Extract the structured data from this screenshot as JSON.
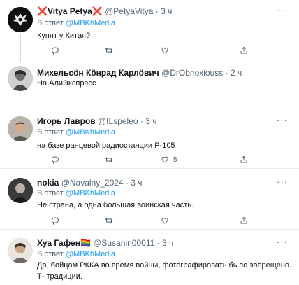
{
  "reply_prefix": "В ответ",
  "tweets": [
    {
      "display_name": "Vitya Petya",
      "cross_left": "❌",
      "cross_right": "❌",
      "handle": "@PetyaVitya",
      "separator": "·",
      "time": "3 ч",
      "reply_mention": "@MBKhMedia",
      "text": "Купят у Китая?",
      "reply_count": "",
      "retweet_count": "",
      "like_count": ""
    },
    {
      "display_name": "Михельсӧн Кӧнрад Карлӧвич",
      "handle": "@DrObnoxiouss",
      "separator": "·",
      "time": "2 ч",
      "text": "На АлиЭкспресс",
      "reply_count": "",
      "retweet_count": "",
      "like_count": ""
    },
    {
      "display_name": "Игорь Лавров",
      "handle": "@ILspeleo",
      "separator": "·",
      "time": "3 ч",
      "reply_mention": "@MBKhMedia",
      "text": "на базе ранцевой радиостанции Р-105",
      "reply_count": "",
      "retweet_count": "",
      "like_count": "5"
    },
    {
      "display_name": "nokia",
      "handle": "@Navalny_2024",
      "separator": "·",
      "time": "3 ч",
      "reply_mention": "@MBKhMedia",
      "text": "Не страна, а одна большая воинская часть.",
      "reply_count": "",
      "retweet_count": "",
      "like_count": ""
    },
    {
      "display_name": "Хуа Гафен",
      "flag": "🏳️‍🌈",
      "handle": "@Susanin00011",
      "separator": "·",
      "time": "3 ч",
      "reply_mention": "@MBKhMedia",
      "text_line1": "Да, бойцам РККА во время войны, фотографировать было запрещено.",
      "text_line2": "Т- традиции."
    }
  ]
}
